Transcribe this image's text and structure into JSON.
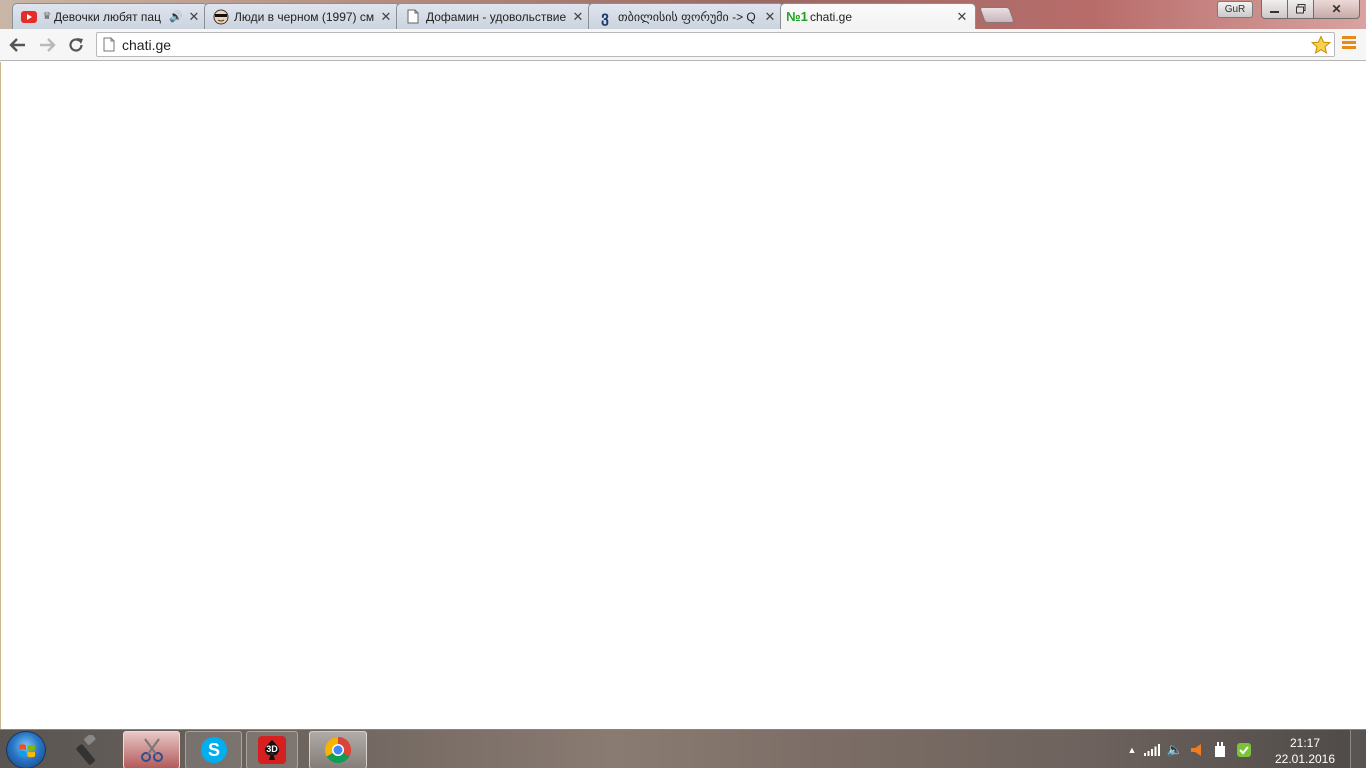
{
  "window": {
    "user_badge": "GuR"
  },
  "tabs": [
    {
      "title": "Девочки любят пац",
      "audio": true,
      "favicon": "youtube-icon",
      "active": false
    },
    {
      "title": "Люди в черном (1997) см",
      "audio": false,
      "favicon": "movie-face-icon",
      "active": false
    },
    {
      "title": "Дофамин - удовольствие",
      "audio": false,
      "favicon": "page-icon",
      "active": false
    },
    {
      "title": "თბილისის ფორუმი -> Q",
      "audio": false,
      "favicon": "forum-icon",
      "active": false
    },
    {
      "title": "chati.ge",
      "audio": false,
      "favicon": "chati-icon",
      "active": true
    }
  ],
  "toolbar": {
    "url": "chati.ge"
  },
  "taskbar": {
    "time": "21:17",
    "date": "22.01.2016",
    "apps": [
      {
        "name": "flashlight",
        "icon": "flashlight-icon"
      },
      {
        "name": "scissors",
        "icon": "scissors-icon"
      },
      {
        "name": "skype",
        "icon": "skype-icon"
      },
      {
        "name": "poker-3d",
        "icon": "poker-icon",
        "label": "3D"
      },
      {
        "name": "chrome",
        "icon": "chrome-icon"
      }
    ]
  },
  "colors": {
    "accent_menu": "#e8891b",
    "star": "#f5b91a",
    "chati_green": "#1fa31f",
    "youtube_red": "#e52d27"
  }
}
